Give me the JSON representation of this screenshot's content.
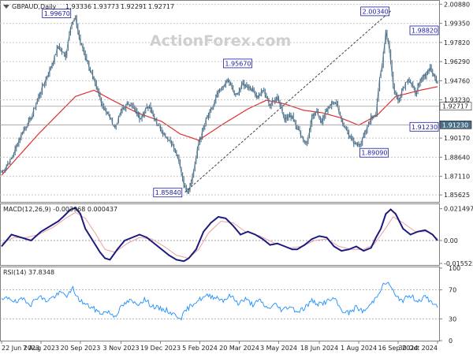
{
  "chart_data": [
    {
      "type": "line",
      "pane": "price",
      "title": "GBPAUD,Daily",
      "ohlc": {
        "open": "1.93336",
        "high": "1.93773",
        "low": "1.92291",
        "close": "1.92717"
      },
      "watermark": "ActionForex.com",
      "ylim": [
        1.8513,
        2.0109
      ],
      "yticks": [
        "2.00880",
        "1.99350",
        "1.97820",
        "1.96290",
        "1.94760",
        "1.93230",
        "1.90170",
        "1.88640",
        "1.87110",
        "1.85625"
      ],
      "current_price": "1.92717",
      "support_level": "1.91230",
      "x_labels": [
        "22 Jun 2023",
        "7 Aug 2023",
        "20 Sep 2023",
        "3 Nov 2023",
        "19 Dec 2023",
        "5 Feb 2024",
        "20 Mar 2024",
        "3 May 2024",
        "18 Jun 2024",
        "1 Aug 2024",
        "16 Sep 2024",
        "30 Oct 2024"
      ],
      "n_bars": 355,
      "price_points": [
        [
          0,
          1.874
        ],
        [
          8,
          1.885
        ],
        [
          16,
          1.905
        ],
        [
          24,
          1.918
        ],
        [
          32,
          1.94
        ],
        [
          40,
          1.958
        ],
        [
          46,
          1.975
        ],
        [
          52,
          1.967
        ],
        [
          56,
          1.992
        ],
        [
          60,
          1.997
        ],
        [
          64,
          1.978
        ],
        [
          70,
          1.962
        ],
        [
          76,
          1.944
        ],
        [
          82,
          1.928
        ],
        [
          88,
          1.918
        ],
        [
          92,
          1.91
        ],
        [
          98,
          1.925
        ],
        [
          104,
          1.93
        ],
        [
          112,
          1.918
        ],
        [
          120,
          1.928
        ],
        [
          126,
          1.914
        ],
        [
          132,
          1.905
        ],
        [
          138,
          1.898
        ],
        [
          142,
          1.889
        ],
        [
          146,
          1.874
        ],
        [
          149,
          1.861
        ],
        [
          152,
          1.86
        ],
        [
          156,
          1.876
        ],
        [
          160,
          1.898
        ],
        [
          166,
          1.916
        ],
        [
          172,
          1.928
        ],
        [
          176,
          1.938
        ],
        [
          180,
          1.943
        ],
        [
          184,
          1.948
        ],
        [
          190,
          1.935
        ],
        [
          196,
          1.945
        ],
        [
          202,
          1.942
        ],
        [
          208,
          1.935
        ],
        [
          212,
          1.94
        ],
        [
          218,
          1.928
        ],
        [
          224,
          1.935
        ],
        [
          230,
          1.917
        ],
        [
          236,
          1.92
        ],
        [
          240,
          1.91
        ],
        [
          244,
          1.902
        ],
        [
          248,
          1.898
        ],
        [
          252,
          1.918
        ],
        [
          256,
          1.922
        ],
        [
          260,
          1.915
        ],
        [
          266,
          1.928
        ],
        [
          272,
          1.93
        ],
        [
          276,
          1.915
        ],
        [
          282,
          1.905
        ],
        [
          286,
          1.897
        ],
        [
          292,
          1.898
        ],
        [
          296,
          1.908
        ],
        [
          300,
          1.918
        ],
        [
          304,
          1.922
        ],
        [
          306,
          1.942
        ],
        [
          309,
          1.96
        ],
        [
          312,
          1.988
        ],
        [
          315,
          1.972
        ],
        [
          318,
          1.943
        ],
        [
          322,
          1.932
        ],
        [
          326,
          1.942
        ],
        [
          330,
          1.95
        ],
        [
          336,
          1.938
        ],
        [
          342,
          1.95
        ],
        [
          348,
          1.958
        ],
        [
          354,
          1.945
        ],
        [
          358,
          1.952
        ],
        [
          362,
          1.935
        ],
        [
          366,
          1.922
        ],
        [
          368,
          1.914
        ],
        [
          372,
          1.93
        ],
        [
          376,
          1.946
        ],
        [
          380,
          1.956
        ],
        [
          384,
          1.962
        ],
        [
          388,
          1.96
        ],
        [
          390,
          1.983
        ],
        [
          394,
          1.975
        ],
        [
          398,
          1.962
        ],
        [
          402,
          1.952
        ],
        [
          406,
          1.948
        ],
        [
          410,
          1.937
        ],
        [
          414,
          1.927
        ]
      ],
      "ma_points": [
        [
          0,
          1.872
        ],
        [
          30,
          1.905
        ],
        [
          60,
          1.935
        ],
        [
          75,
          1.94
        ],
        [
          90,
          1.932
        ],
        [
          110,
          1.922
        ],
        [
          130,
          1.915
        ],
        [
          145,
          1.905
        ],
        [
          160,
          1.9
        ],
        [
          180,
          1.913
        ],
        [
          200,
          1.925
        ],
        [
          215,
          1.932
        ],
        [
          230,
          1.929
        ],
        [
          245,
          1.924
        ],
        [
          260,
          1.922
        ],
        [
          275,
          1.918
        ],
        [
          290,
          1.912
        ],
        [
          305,
          1.92
        ],
        [
          320,
          1.935
        ],
        [
          340,
          1.94
        ],
        [
          360,
          1.944
        ],
        [
          375,
          1.943
        ],
        [
          390,
          1.946
        ],
        [
          405,
          1.948
        ],
        [
          414,
          1.945
        ]
      ],
      "trendline": {
        "from": [
          149,
          1.8584
        ],
        "to": [
          316,
          2.0034
        ]
      },
      "annotations": [
        {
          "label": "1.99670",
          "x": 60,
          "y": 1.9967
        },
        {
          "label": "1.95670",
          "x": 184,
          "y": 1.9567
        },
        {
          "label": "1.85840",
          "x": 149,
          "y": 1.8584
        },
        {
          "label": "2.00340",
          "x": 316,
          "y": 2.0034
        },
        {
          "label": "1.98820",
          "x": 387,
          "y": 1.9882
        },
        {
          "label": "1.89090",
          "x": 296,
          "y": 1.8909
        },
        {
          "label": "1.91230",
          "x": 368,
          "y": 1.9123
        }
      ],
      "colors": {
        "price": "#4a6f89",
        "ma": "#e03030",
        "trend": "#404040",
        "label_border": "#1a1a9e",
        "label_text": "#1a1a9e"
      }
    },
    {
      "type": "line",
      "pane": "macd",
      "title": "MACD(12,26,9) -0.003968 0.000437",
      "ylim": [
        -0.016,
        0.024
      ],
      "yticks": [
        "0.021497",
        "0.00",
        "-0.015525"
      ],
      "macd_points": [
        [
          0,
          -0.004
        ],
        [
          8,
          0.004
        ],
        [
          16,
          0.002
        ],
        [
          24,
          0.0
        ],
        [
          32,
          0.006
        ],
        [
          40,
          0.01
        ],
        [
          46,
          0.013
        ],
        [
          50,
          0.016
        ],
        [
          56,
          0.021
        ],
        [
          60,
          0.022
        ],
        [
          64,
          0.018
        ],
        [
          68,
          0.008
        ],
        [
          74,
          0.0
        ],
        [
          80,
          -0.008
        ],
        [
          84,
          -0.012
        ],
        [
          88,
          -0.013
        ],
        [
          94,
          -0.006
        ],
        [
          100,
          0.0
        ],
        [
          106,
          0.002
        ],
        [
          112,
          0.004
        ],
        [
          118,
          0.002
        ],
        [
          124,
          -0.002
        ],
        [
          130,
          -0.006
        ],
        [
          136,
          -0.01
        ],
        [
          142,
          -0.013
        ],
        [
          148,
          -0.014
        ],
        [
          152,
          -0.012
        ],
        [
          158,
          -0.006
        ],
        [
          164,
          0.006
        ],
        [
          170,
          0.012
        ],
        [
          176,
          0.016
        ],
        [
          182,
          0.015
        ],
        [
          188,
          0.01
        ],
        [
          194,
          0.004
        ],
        [
          200,
          0.006
        ],
        [
          206,
          0.004
        ],
        [
          212,
          0.001
        ],
        [
          218,
          -0.003
        ],
        [
          224,
          -0.002
        ],
        [
          230,
          -0.004
        ],
        [
          236,
          -0.006
        ],
        [
          240,
          -0.006
        ],
        [
          246,
          -0.003
        ],
        [
          252,
          0.001
        ],
        [
          258,
          0.003
        ],
        [
          264,
          0.002
        ],
        [
          270,
          -0.004
        ],
        [
          276,
          -0.007
        ],
        [
          282,
          -0.006
        ],
        [
          288,
          -0.004
        ],
        [
          294,
          -0.007
        ],
        [
          300,
          -0.005
        ],
        [
          304,
          0.002
        ],
        [
          308,
          0.008
        ],
        [
          312,
          0.018
        ],
        [
          316,
          0.021
        ],
        [
          320,
          0.018
        ],
        [
          326,
          0.008
        ],
        [
          332,
          0.004
        ],
        [
          338,
          0.006
        ],
        [
          344,
          0.007
        ],
        [
          350,
          0.004
        ],
        [
          356,
          -0.002
        ],
        [
          360,
          -0.008
        ],
        [
          364,
          -0.009
        ],
        [
          368,
          -0.008
        ],
        [
          374,
          -0.002
        ],
        [
          380,
          0.005
        ],
        [
          386,
          0.009
        ],
        [
          390,
          0.011
        ],
        [
          396,
          0.008
        ],
        [
          402,
          0.004
        ],
        [
          406,
          0.0
        ],
        [
          410,
          -0.002
        ],
        [
          414,
          -0.004
        ]
      ],
      "signal_points": [
        [
          0,
          -0.002
        ],
        [
          10,
          0.002
        ],
        [
          20,
          0.002
        ],
        [
          30,
          0.004
        ],
        [
          42,
          0.009
        ],
        [
          52,
          0.015
        ],
        [
          60,
          0.019
        ],
        [
          68,
          0.015
        ],
        [
          76,
          0.005
        ],
        [
          84,
          -0.006
        ],
        [
          92,
          -0.008
        ],
        [
          102,
          -0.002
        ],
        [
          112,
          0.002
        ],
        [
          122,
          0.001
        ],
        [
          132,
          -0.004
        ],
        [
          142,
          -0.01
        ],
        [
          152,
          -0.012
        ],
        [
          160,
          -0.006
        ],
        [
          168,
          0.005
        ],
        [
          178,
          0.013
        ],
        [
          188,
          0.012
        ],
        [
          198,
          0.006
        ],
        [
          210,
          0.003
        ],
        [
          222,
          -0.002
        ],
        [
          234,
          -0.005
        ],
        [
          244,
          -0.004
        ],
        [
          254,
          0.0
        ],
        [
          264,
          0.001
        ],
        [
          274,
          -0.004
        ],
        [
          284,
          -0.006
        ],
        [
          294,
          -0.006
        ],
        [
          302,
          -0.003
        ],
        [
          310,
          0.006
        ],
        [
          318,
          0.016
        ],
        [
          326,
          0.012
        ],
        [
          336,
          0.006
        ],
        [
          346,
          0.006
        ],
        [
          356,
          0.0
        ],
        [
          364,
          -0.006
        ],
        [
          372,
          -0.005
        ],
        [
          382,
          0.003
        ],
        [
          392,
          0.008
        ],
        [
          402,
          0.005
        ],
        [
          414,
          0.0004
        ]
      ],
      "colors": {
        "macd": "#1a1a80",
        "signal": "#e9a0a0",
        "zero": "#808080"
      }
    },
    {
      "type": "line",
      "pane": "rsi",
      "title": "RSI(14) 37.8348",
      "ylim": [
        0,
        100
      ],
      "yticks": [
        "100",
        "70",
        "30",
        "0"
      ],
      "rsi_points": [
        [
          0,
          55
        ],
        [
          6,
          60
        ],
        [
          12,
          52
        ],
        [
          18,
          58
        ],
        [
          24,
          50
        ],
        [
          30,
          62
        ],
        [
          36,
          55
        ],
        [
          42,
          60
        ],
        [
          48,
          66
        ],
        [
          54,
          62
        ],
        [
          58,
          72
        ],
        [
          62,
          58
        ],
        [
          68,
          50
        ],
        [
          74,
          45
        ],
        [
          80,
          38
        ],
        [
          86,
          40
        ],
        [
          92,
          34
        ],
        [
          98,
          48
        ],
        [
          104,
          55
        ],
        [
          110,
          50
        ],
        [
          116,
          57
        ],
        [
          122,
          48
        ],
        [
          128,
          44
        ],
        [
          134,
          42
        ],
        [
          140,
          36
        ],
        [
          146,
          32
        ],
        [
          150,
          42
        ],
        [
          156,
          52
        ],
        [
          162,
          58
        ],
        [
          168,
          62
        ],
        [
          174,
          60
        ],
        [
          180,
          56
        ],
        [
          186,
          62
        ],
        [
          192,
          52
        ],
        [
          198,
          57
        ],
        [
          204,
          50
        ],
        [
          210,
          55
        ],
        [
          216,
          44
        ],
        [
          222,
          50
        ],
        [
          228,
          42
        ],
        [
          234,
          48
        ],
        [
          240,
          40
        ],
        [
          246,
          45
        ],
        [
          252,
          55
        ],
        [
          258,
          50
        ],
        [
          264,
          54
        ],
        [
          270,
          58
        ],
        [
          276,
          42
        ],
        [
          282,
          38
        ],
        [
          288,
          46
        ],
        [
          294,
          40
        ],
        [
          300,
          50
        ],
        [
          304,
          60
        ],
        [
          308,
          72
        ],
        [
          312,
          80
        ],
        [
          316,
          76
        ],
        [
          320,
          60
        ],
        [
          326,
          56
        ],
        [
          332,
          62
        ],
        [
          338,
          55
        ],
        [
          344,
          60
        ],
        [
          350,
          52
        ],
        [
          356,
          46
        ],
        [
          360,
          40
        ],
        [
          364,
          36
        ],
        [
          368,
          44
        ],
        [
          374,
          55
        ],
        [
          380,
          62
        ],
        [
          386,
          66
        ],
        [
          390,
          72
        ],
        [
          394,
          60
        ],
        [
          400,
          54
        ],
        [
          406,
          58
        ],
        [
          410,
          44
        ],
        [
          414,
          38
        ]
      ],
      "colors": {
        "rsi": "#1e90ff"
      }
    }
  ]
}
